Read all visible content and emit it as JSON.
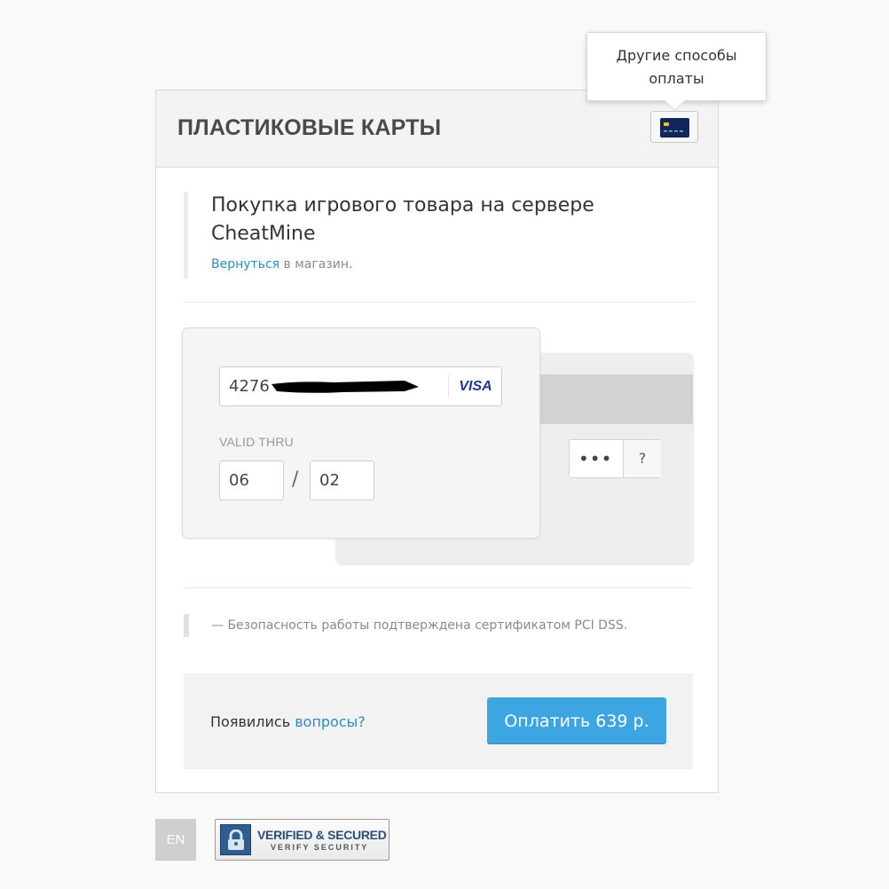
{
  "header": {
    "title": "ПЛАСТИКОВЫЕ КАРТЫ",
    "tooltip": "Другие способы оплаты"
  },
  "order": {
    "title": "Покупка игрового товара на сервере CheatMine",
    "back_link": "Вернуться",
    "back_suffix": " в магазин."
  },
  "card": {
    "number_prefix": "4276",
    "brand": "VISA",
    "valid_label": "VALID THRU",
    "month": "06",
    "separator": "/",
    "year": "02",
    "cvv": "•••",
    "cvv_help": "?"
  },
  "security_note": "— Безопасность работы подтверждена сертификатом PCI DSS.",
  "footer": {
    "question_prefix": "Появились ",
    "question_link": "вопросы?",
    "pay_button": "Оплатить 639 р."
  },
  "bottom": {
    "lang": "EN",
    "badge_line1": "VERIFIED & SECURED",
    "badge_line2": "VERIFY SECURITY"
  },
  "colors": {
    "accent": "#3ca5e2",
    "link": "#2a8ec4",
    "card_icon": "#13265a"
  },
  "icons": {
    "card_switch": "credit-card-icon",
    "badge": "lock-icon"
  }
}
